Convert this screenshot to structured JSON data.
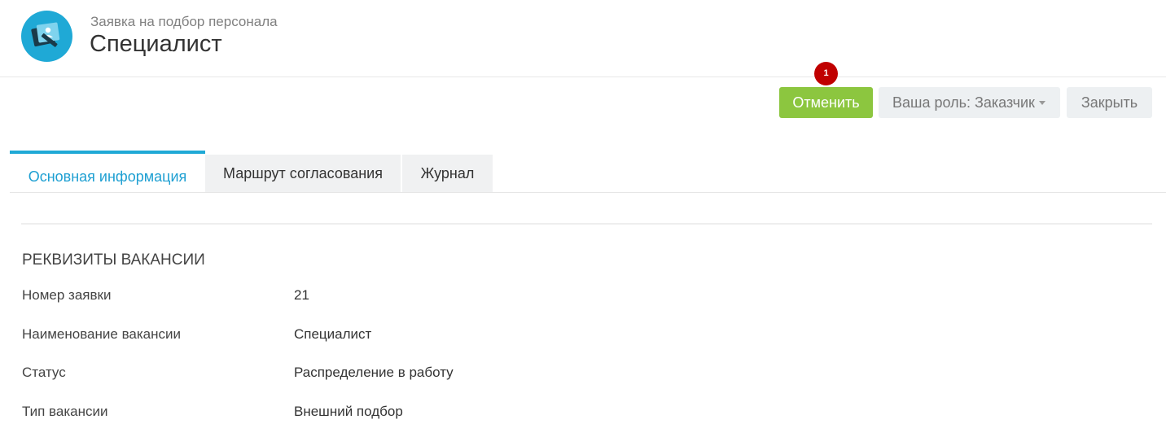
{
  "header": {
    "subtitle": "Заявка на подбор персонала",
    "title": "Специалист",
    "logo_icon": "edit-document-icon",
    "logo_color": "#1fa9d6"
  },
  "toolbar": {
    "cancel_label": "Отменить",
    "role_label": "Ваша роль: Заказчик",
    "close_label": "Закрыть",
    "badge_count": "1",
    "cancel_color": "#8cc63f",
    "badge_color": "#c00000"
  },
  "tabs": [
    {
      "label": "Основная информация",
      "active": true
    },
    {
      "label": "Маршрут согласования",
      "active": false
    },
    {
      "label": "Журнал",
      "active": false
    }
  ],
  "section": {
    "title": "РЕКВИЗИТЫ ВАКАНСИИ",
    "rows": [
      {
        "label": "Номер заявки",
        "value": "21"
      },
      {
        "label": "Наименование вакансии",
        "value": "Специалист"
      },
      {
        "label": "Статус",
        "value": "Распределение в работу"
      },
      {
        "label": "Тип вакансии",
        "value": "Внешний подбор"
      }
    ]
  },
  "accent_color": "#1fa9d6"
}
